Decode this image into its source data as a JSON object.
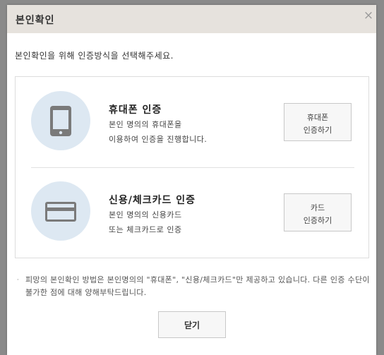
{
  "dialog": {
    "title": "본인확인",
    "close_icon": "close-icon",
    "close_glyph": "×"
  },
  "intro": "본인확인을 위해 인증방식을 선택해주세요.",
  "methods": [
    {
      "icon": "mobile-phone-icon",
      "title": "휴대폰 인증",
      "desc_line1": "본인 명의의 휴대폰을",
      "desc_line2": "이용하여 인증을 진행합니다.",
      "button_line1": "휴대폰",
      "button_line2": "인증하기"
    },
    {
      "icon": "credit-card-icon",
      "title": "신용/체크카드 인증",
      "desc_line1": "본인 명의의 신용카드",
      "desc_line2": "또는 체크카드로 인증",
      "button_line1": "카드",
      "button_line2": "인증하기"
    }
  ],
  "notice": {
    "bullet": "·",
    "text": "피망의 본인확인 방법은 본인명의의 \"휴대폰\", \"신용/체크카드\"만 제공하고 있습니다. 다른 인증 수단이 불가한 점에 대해 양해부탁드립니다."
  },
  "footer": {
    "close_label": "닫기"
  },
  "colors": {
    "titlebar_bg": "#e6e2dd",
    "icon_circle_bg": "#dde8f2",
    "icon_color": "#7a7a7a",
    "overlay_bg": "#8a8a8a"
  }
}
